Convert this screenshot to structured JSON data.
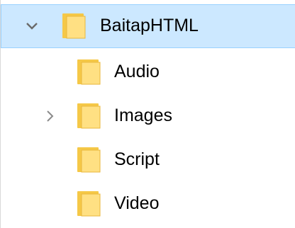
{
  "tree": {
    "root": {
      "label": "BaitapHTML",
      "expanded": true,
      "selected": true
    },
    "children": [
      {
        "label": "Audio",
        "has_children": false
      },
      {
        "label": "Images",
        "has_children": true
      },
      {
        "label": "Script",
        "has_children": false
      },
      {
        "label": "Video",
        "has_children": false
      }
    ]
  },
  "colors": {
    "selection_bg": "#cce8ff",
    "selection_border": "#99d1ff",
    "folder_fill": "#ffe083",
    "folder_tab": "#f5c847",
    "chevron": "#6a6a6a"
  },
  "icons": {
    "expand": "chevron-down-icon",
    "collapse": "chevron-right-icon",
    "folder": "folder-icon"
  }
}
